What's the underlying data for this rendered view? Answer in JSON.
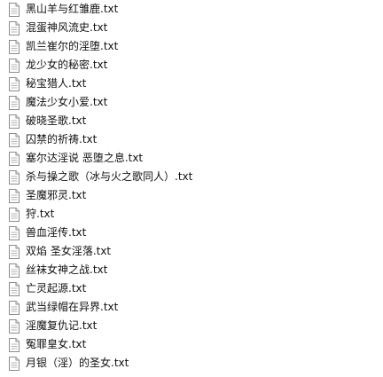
{
  "files": [
    {
      "name": "黑山羊与红雏鹿.txt",
      "icon": "text-file-icon"
    },
    {
      "name": "混蛋神风流史.txt",
      "icon": "text-file-icon"
    },
    {
      "name": "凯兰崔尔的淫堕.txt",
      "icon": "text-file-icon"
    },
    {
      "name": "龙少女的秘密.txt",
      "icon": "text-file-icon"
    },
    {
      "name": "秘宝猎人.txt",
      "icon": "text-file-icon"
    },
    {
      "name": "魔法少女小爱.txt",
      "icon": "text-file-icon"
    },
    {
      "name": "破晓圣歌.txt",
      "icon": "text-file-icon"
    },
    {
      "name": "囚禁的祈祷.txt",
      "icon": "text-file-icon"
    },
    {
      "name": "塞尔达淫说 恶堕之息.txt",
      "icon": "text-file-icon"
    },
    {
      "name": "杀与操之歌（冰与火之歌同人）.txt",
      "icon": "text-file-icon"
    },
    {
      "name": "圣魔邪灵.txt",
      "icon": "text-file-icon"
    },
    {
      "name": "狩.txt",
      "icon": "text-file-icon"
    },
    {
      "name": "兽血淫传.txt",
      "icon": "text-file-icon"
    },
    {
      "name": "双焰 圣女淫落.txt",
      "icon": "text-file-icon"
    },
    {
      "name": "丝袜女神之战.txt",
      "icon": "text-file-icon"
    },
    {
      "name": "亡灵起源.txt",
      "icon": "text-file-icon"
    },
    {
      "name": "武当绿帽在异界.txt",
      "icon": "text-file-icon"
    },
    {
      "name": "淫魔复仇记.txt",
      "icon": "text-file-icon"
    },
    {
      "name": "冤罪皇女.txt",
      "icon": "text-file-icon"
    },
    {
      "name": "月银（淫）的圣女.txt",
      "icon": "text-file-icon"
    }
  ]
}
